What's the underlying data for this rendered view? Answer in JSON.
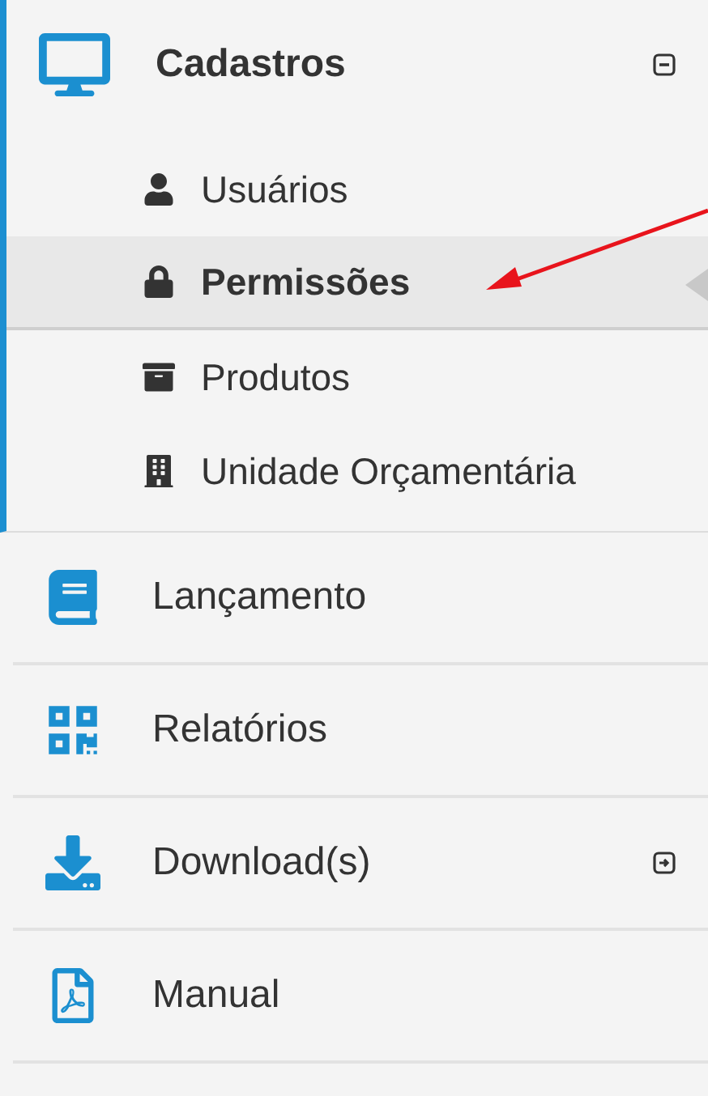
{
  "menu": [
    {
      "label": "Cadastros",
      "expanded": true,
      "children": [
        {
          "label": "Usuários",
          "selected": false
        },
        {
          "label": "Permissões",
          "selected": true
        },
        {
          "label": "Produtos",
          "selected": false
        },
        {
          "label": "Unidade Orçamentária",
          "selected": false
        }
      ]
    },
    {
      "label": "Lançamento"
    },
    {
      "label": "Relatórios"
    },
    {
      "label": "Download(s)",
      "expanded": false
    },
    {
      "label": "Manual"
    }
  ]
}
